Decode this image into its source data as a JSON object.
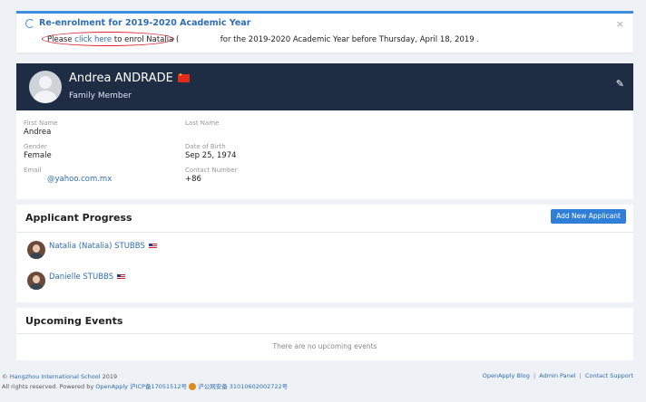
{
  "notice": {
    "title": "Re-enrolment for 2019-2020 Academic Year",
    "body_prefix": "Please",
    "link_text": "click here",
    "body_middle": "to enrol Natalia (",
    "body_suffix": "for the 2019-2020 Academic Year before Thursday, April 18, 2019 .",
    "close_glyph": "×",
    "highlight_color": "#dd2233"
  },
  "profile": {
    "name": "Andrea ANDRADE",
    "role": "Family Member",
    "flag_icon": "china-flag-icon",
    "edit_icon": "pencil-icon",
    "header_color": "#1e2c44"
  },
  "details": {
    "first_name_label": "First Name",
    "first_name": "Andrea",
    "last_name_label": "Last Name",
    "last_name": "",
    "gender_label": "Gender",
    "gender": "Female",
    "dob_label": "Date of Birth",
    "dob": "Sep 25, 1974",
    "email_label": "Email",
    "email": "@yahoo.com.mx",
    "contact_label": "Contact Number",
    "contact": "+86"
  },
  "progress": {
    "title": "Applicant Progress",
    "add_button": "Add New Applicant",
    "applicants": [
      {
        "name": "Natalia (Natalia) STUBBS",
        "flag": "usa-flag-icon"
      },
      {
        "name": "Danielle STUBBS",
        "flag": "usa-flag-icon"
      }
    ]
  },
  "events": {
    "title": "Upcoming Events",
    "empty_text": "There are no upcoming events"
  },
  "footer": {
    "copyright_prefix": "©",
    "school": "Hangzhou International School",
    "year": "2019",
    "rights": "All rights reserved. Powered by",
    "openapply": "OpenApply",
    "icp": "沪ICP备17051512号",
    "police": "沪公网安备 31010602002722号",
    "links": [
      "OpenApply Blog",
      "Admin Panel",
      "Contact Support"
    ],
    "separator": "|"
  },
  "colors": {
    "accent": "#2f6db5",
    "button": "#2f7fd8",
    "background": "#eef1f6"
  }
}
